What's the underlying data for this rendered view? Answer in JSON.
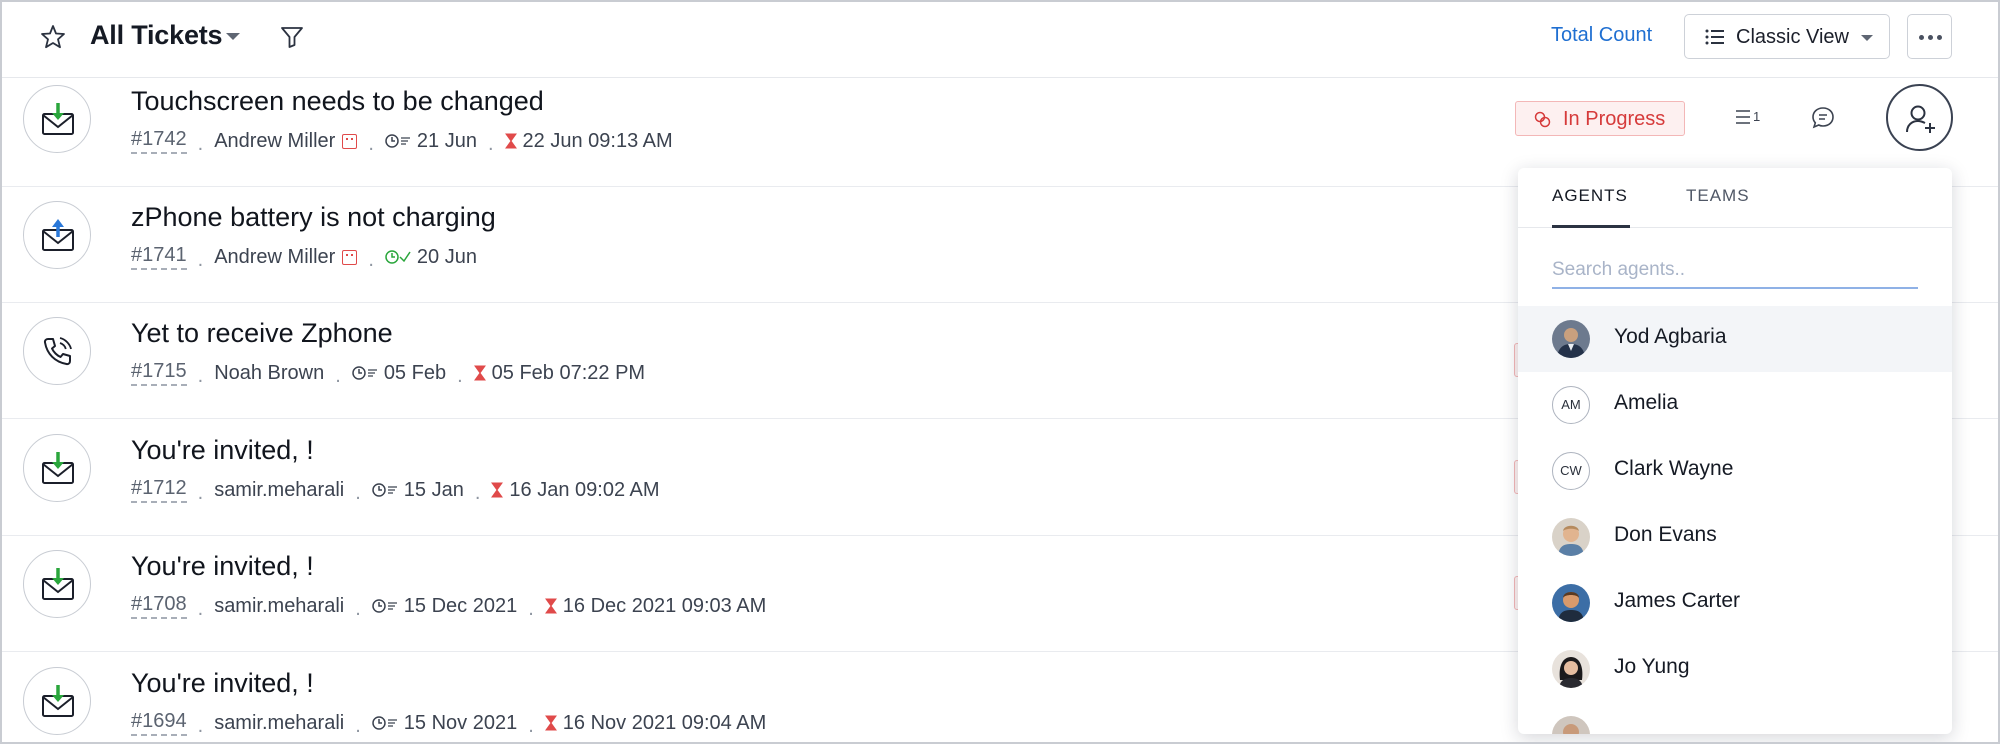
{
  "header": {
    "title": "All Tickets",
    "total_count_label": "Total Count",
    "view_label": "Classic View"
  },
  "tickets": [
    {
      "subject": "Touchscreen needs to be changed",
      "id": "#1742",
      "contact": "Andrew Miller",
      "created": "21 Jun",
      "due": "22 Jun 09:13 AM",
      "channel": "email-incoming",
      "status": "In Progress",
      "thread_count": "1"
    },
    {
      "subject": "zPhone battery is not charging",
      "id": "#1741",
      "contact": "Andrew Miller",
      "created": "20 Jun",
      "channel": "email-outgoing"
    },
    {
      "subject": "Yet to receive Zphone",
      "id": "#1715",
      "contact": "Noah Brown",
      "created": "05 Feb",
      "due": "05 Feb 07:22 PM",
      "channel": "phone"
    },
    {
      "subject": "You're invited, !",
      "id": "#1712",
      "contact": "samir.meharali",
      "created": "15 Jan",
      "due": "16 Jan 09:02 AM",
      "channel": "email-incoming"
    },
    {
      "subject": "You're invited, !",
      "id": "#1708",
      "contact": "samir.meharali",
      "created": "15 Dec 2021",
      "due": "16 Dec 2021 09:03 AM",
      "channel": "email-incoming"
    },
    {
      "subject": "You're invited, !",
      "id": "#1694",
      "contact": "samir.meharali",
      "created": "15 Nov 2021",
      "due": "16 Nov 2021 09:04 AM",
      "channel": "email-incoming"
    }
  ],
  "assign_dropdown": {
    "tabs": [
      "AGENTS",
      "TEAMS"
    ],
    "search_placeholder": "Search agents..",
    "agents": [
      {
        "name": "Yod Agbaria",
        "avatar": "photo"
      },
      {
        "name": "Amelia",
        "initials": "AM"
      },
      {
        "name": "Clark Wayne",
        "initials": "CW"
      },
      {
        "name": "Don Evans",
        "avatar": "photo"
      },
      {
        "name": "James Carter",
        "avatar": "photo"
      },
      {
        "name": "Jo Yung",
        "avatar": "photo"
      }
    ]
  },
  "colors": {
    "accent": "#1f6fd1",
    "status_text": "#d63b3b",
    "status_bg": "#fdf0f0",
    "incoming_arrow": "#2aa63c",
    "outgoing_arrow": "#2a78d8"
  }
}
